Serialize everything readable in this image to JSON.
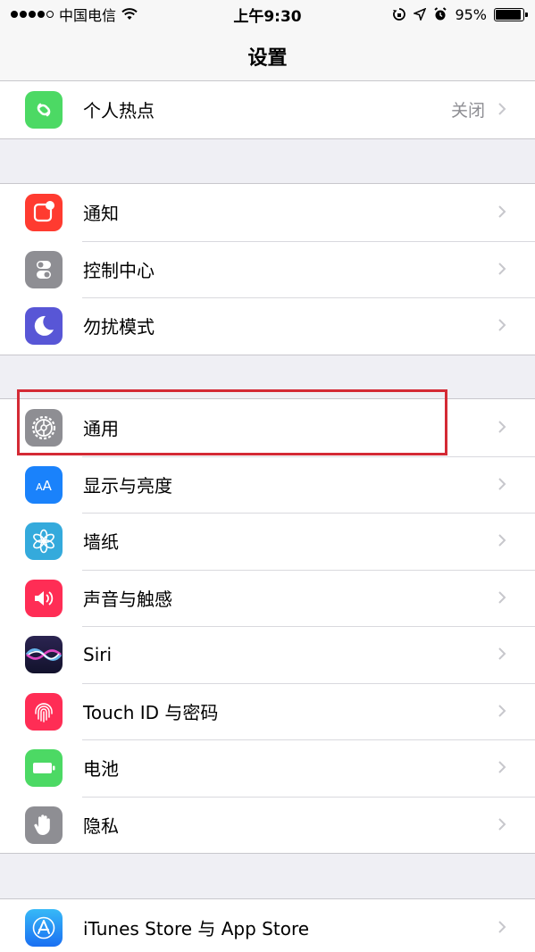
{
  "status_bar": {
    "carrier": "中国电信",
    "time": "上午9:30",
    "battery": "95%"
  },
  "nav": {
    "title": "设置"
  },
  "groups": [
    {
      "rows": [
        {
          "label": "个人热点",
          "value": "关闭",
          "icon": "hotspot-icon",
          "color": "#4cd964"
        }
      ]
    },
    {
      "rows": [
        {
          "label": "通知",
          "icon": "notifications-icon",
          "color": "#ff3b30"
        },
        {
          "label": "控制中心",
          "icon": "control-center-icon",
          "color": "#8e8e93"
        },
        {
          "label": "勿扰模式",
          "icon": "moon-icon",
          "color": "#5856d6"
        }
      ]
    },
    {
      "rows": [
        {
          "label": "通用",
          "icon": "gear-icon",
          "color": "#8e8e93"
        },
        {
          "label": "显示与亮度",
          "icon": "display-brightness-icon",
          "color": "#1a82fb"
        },
        {
          "label": "墙纸",
          "icon": "wallpaper-icon",
          "color": "#34aadc"
        },
        {
          "label": "声音与触感",
          "icon": "speaker-icon",
          "color": "#ff2d55"
        },
        {
          "label": "Siri",
          "icon": "siri-icon",
          "color": "#1b1b3a"
        },
        {
          "label": "Touch ID 与密码",
          "icon": "fingerprint-icon",
          "color": "#ff2d55"
        },
        {
          "label": "电池",
          "icon": "battery-icon",
          "color": "#4cd964"
        },
        {
          "label": "隐私",
          "icon": "hand-icon",
          "color": "#8e8e93"
        }
      ]
    },
    {
      "rows": [
        {
          "label": "iTunes Store 与 App Store",
          "icon": "app-store-icon",
          "color": "#1a82fb"
        }
      ]
    }
  ],
  "highlight_color": "#d42a35"
}
